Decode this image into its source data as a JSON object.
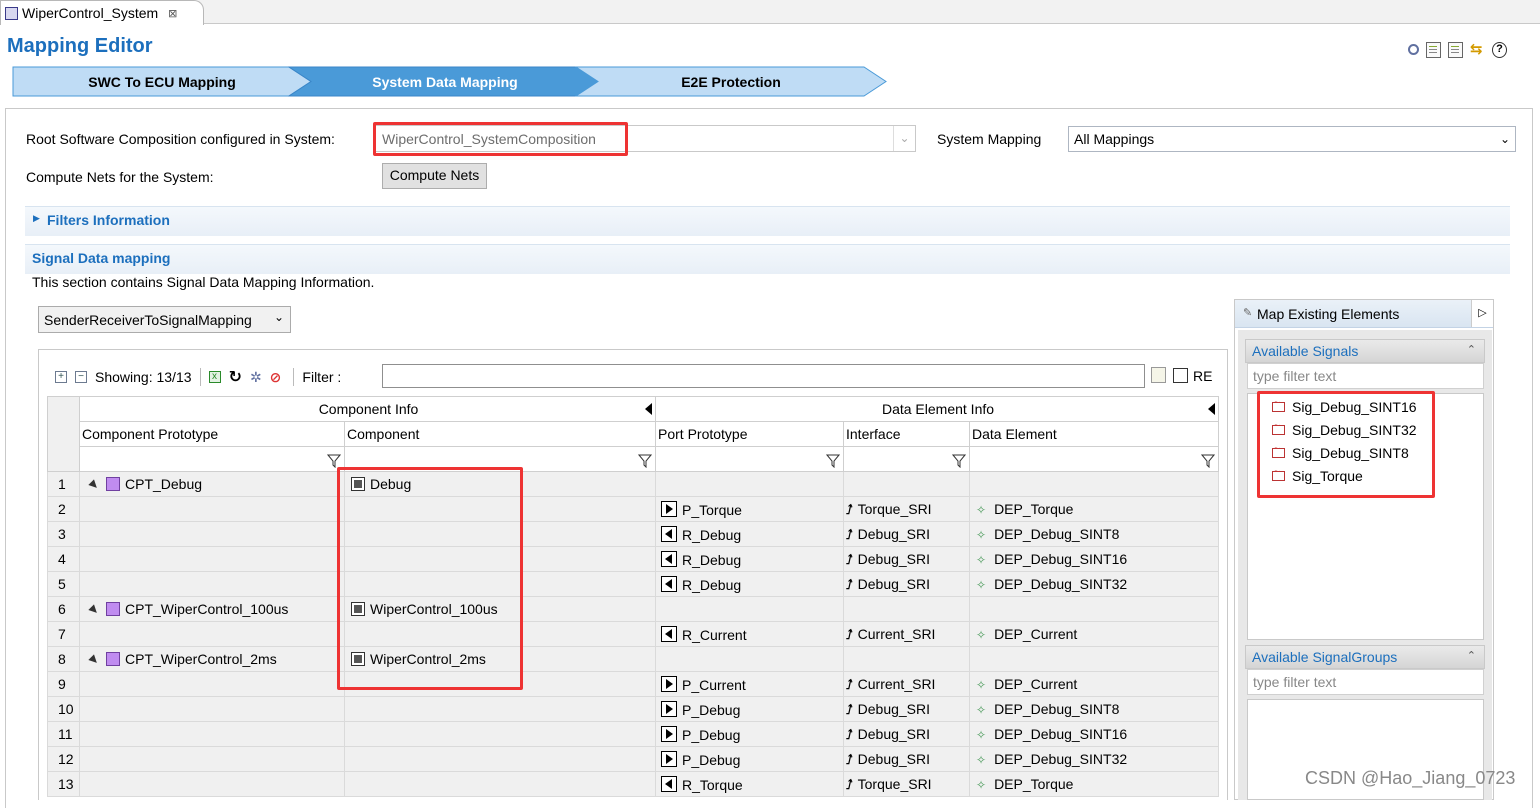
{
  "editor_tab": {
    "title": "WiperControl_System",
    "close": "⊠"
  },
  "editor": {
    "title": "Mapping Editor"
  },
  "steps": [
    {
      "label": "SWC To ECU Mapping",
      "active": false
    },
    {
      "label": "System Data Mapping",
      "active": true
    },
    {
      "label": "E2E Protection",
      "active": false
    }
  ],
  "form": {
    "root_label": "Root Software Composition configured in System:",
    "root_value": "WiperControl_SystemComposition",
    "system_mapping_label": "System Mapping",
    "system_mapping_value": "All Mappings",
    "compute_label": "Compute Nets for the System:",
    "compute_button": "Compute Nets"
  },
  "filters_section": {
    "title": "Filters Information"
  },
  "signal_section": {
    "title": "Signal Data mapping",
    "description": "This section contains Signal Data Mapping Information.",
    "mapping_type": "SenderReceiverToSignalMapping"
  },
  "grid_toolbar": {
    "showing": "Showing: 13/13",
    "filter_label": "Filter :",
    "filter_value": "",
    "re_label": "RE"
  },
  "grid": {
    "group_headers": [
      "Component Info",
      "Data Element Info"
    ],
    "columns": [
      "Component Prototype",
      "Component",
      "Port Prototype",
      "Interface",
      "Data Element"
    ],
    "rows": [
      {
        "n": "1",
        "proto": "CPT_Debug",
        "comp": "Debug",
        "port": "",
        "dir": "",
        "iface": "",
        "de": ""
      },
      {
        "n": "2",
        "proto": "",
        "comp": "",
        "port": "P_Torque",
        "dir": "out",
        "iface": "Torque_SRI",
        "de": "DEP_Torque"
      },
      {
        "n": "3",
        "proto": "",
        "comp": "",
        "port": "R_Debug",
        "dir": "in",
        "iface": "Debug_SRI",
        "de": "DEP_Debug_SINT8"
      },
      {
        "n": "4",
        "proto": "",
        "comp": "",
        "port": "R_Debug",
        "dir": "in",
        "iface": "Debug_SRI",
        "de": "DEP_Debug_SINT16"
      },
      {
        "n": "5",
        "proto": "",
        "comp": "",
        "port": "R_Debug",
        "dir": "in",
        "iface": "Debug_SRI",
        "de": "DEP_Debug_SINT32"
      },
      {
        "n": "6",
        "proto": "CPT_WiperControl_100us",
        "comp": "WiperControl_100us",
        "port": "",
        "dir": "",
        "iface": "",
        "de": ""
      },
      {
        "n": "7",
        "proto": "",
        "comp": "",
        "port": "R_Current",
        "dir": "in",
        "iface": "Current_SRI",
        "de": "DEP_Current"
      },
      {
        "n": "8",
        "proto": "CPT_WiperControl_2ms",
        "comp": "WiperControl_2ms",
        "port": "",
        "dir": "",
        "iface": "",
        "de": ""
      },
      {
        "n": "9",
        "proto": "",
        "comp": "",
        "port": "P_Current",
        "dir": "out",
        "iface": "Current_SRI",
        "de": "DEP_Current"
      },
      {
        "n": "10",
        "proto": "",
        "comp": "",
        "port": "P_Debug",
        "dir": "out",
        "iface": "Debug_SRI",
        "de": "DEP_Debug_SINT8"
      },
      {
        "n": "11",
        "proto": "",
        "comp": "",
        "port": "P_Debug",
        "dir": "out",
        "iface": "Debug_SRI",
        "de": "DEP_Debug_SINT16"
      },
      {
        "n": "12",
        "proto": "",
        "comp": "",
        "port": "P_Debug",
        "dir": "out",
        "iface": "Debug_SRI",
        "de": "DEP_Debug_SINT32"
      },
      {
        "n": "13",
        "proto": "",
        "comp": "",
        "port": "R_Torque",
        "dir": "in",
        "iface": "Torque_SRI",
        "de": "DEP_Torque"
      }
    ]
  },
  "map_view": {
    "title": "Map Existing Elements",
    "signals_header": "Available Signals",
    "signals_filter_placeholder": "type filter text",
    "signals": [
      "Sig_Debug_SINT16",
      "Sig_Debug_SINT32",
      "Sig_Debug_SINT8",
      "Sig_Torque"
    ],
    "groups_header": "Available SignalGroups",
    "groups_filter_placeholder": "type filter text"
  },
  "watermark": "CSDN @Hao_Jiang_0723",
  "colors": {
    "accent": "#1c6fbd",
    "highlight": "#e33333",
    "active_step": "#4a9ad8",
    "inactive_step": "#bfdcf5"
  }
}
